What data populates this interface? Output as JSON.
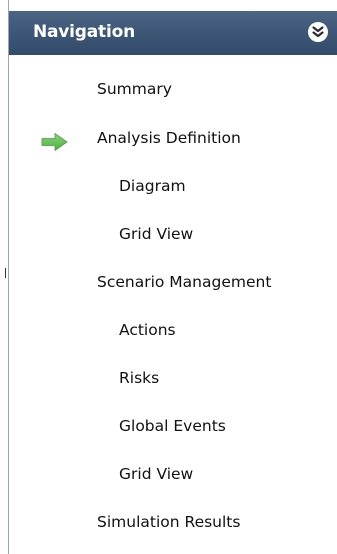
{
  "navigation": {
    "title": "Navigation",
    "toggle_icon": "double-chevron-down-icon",
    "current_indicator_icon": "green-arrow-right-icon",
    "colors": {
      "header": "#3f5878",
      "arrow": "#5cb85c"
    },
    "items": [
      {
        "label": "Summary"
      },
      {
        "label": "Analysis Definition",
        "current": true
      },
      {
        "label": "Diagram"
      },
      {
        "label": "Grid View"
      },
      {
        "label": "Scenario Management"
      },
      {
        "label": "Actions"
      },
      {
        "label": "Risks"
      },
      {
        "label": "Global Events"
      },
      {
        "label": "Grid View"
      },
      {
        "label": "Simulation Results"
      }
    ]
  }
}
